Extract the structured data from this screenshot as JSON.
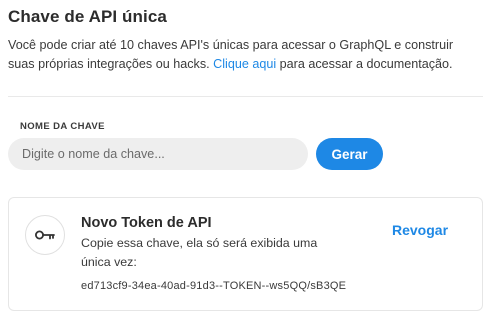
{
  "section": {
    "title": "Chave de API única",
    "description_before_link": "Você pode criar até 10 chaves API's únicas para acessar o GraphQL e construir suas próprias integrações ou hacks. ",
    "link_text": "Clique aqui",
    "description_after_link": " para acessar a documentação."
  },
  "form": {
    "label": "NOME DA CHAVE",
    "placeholder": "Digite o nome da chave...",
    "value": "",
    "submit_label": "Gerar"
  },
  "token_card": {
    "icon": "key-icon",
    "title": "Novo Token de API",
    "description": "Copie essa chave, ela só será exibida uma única vez:",
    "token": "ed713cf9-34ea-40ad-91d3--TOKEN--ws5QQ/sB3QE",
    "revoke_label": "Revogar"
  },
  "colors": {
    "accent": "#1e88e5",
    "input_background": "#eeeeee",
    "border": "#e6e6e6"
  }
}
